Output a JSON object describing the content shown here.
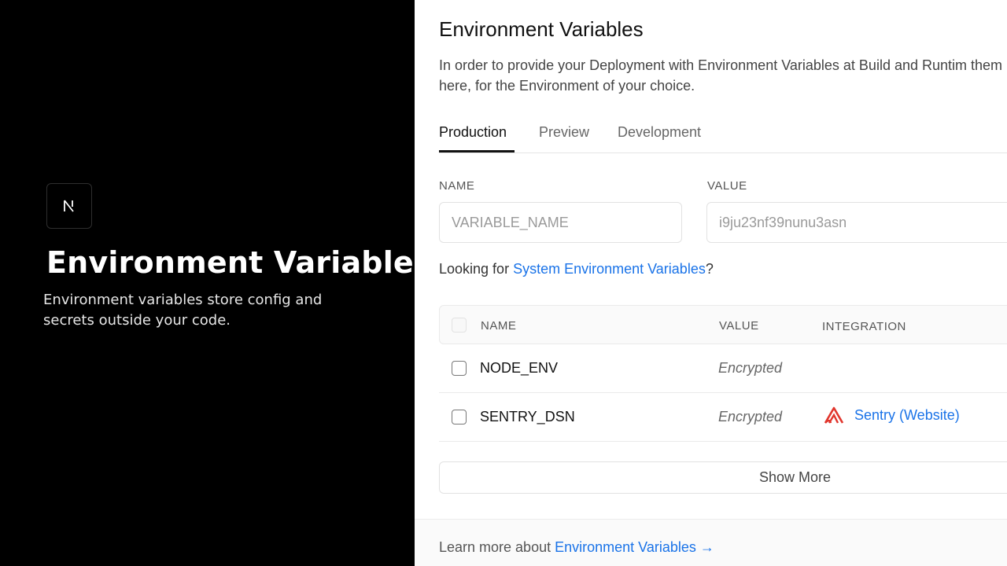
{
  "hero": {
    "logo_icon": "nextjs-logo-icon",
    "title": "Environment Variable",
    "subtitle": "Environment variables store config and secrets outside your code."
  },
  "panel": {
    "title": "Environment Variables",
    "description": "In order to provide your Deployment with Environment Variables at Build and Runtim them right here, for the Environment of your choice.",
    "tabs": [
      {
        "label": "Production",
        "active": true
      },
      {
        "label": "Preview",
        "active": false
      },
      {
        "label": "Development",
        "active": false
      }
    ],
    "form": {
      "name_label": "NAME",
      "name_placeholder": "VARIABLE_NAME",
      "value_label": "VALUE",
      "value_placeholder": "i9ju23nf39nunu3asn"
    },
    "system_hint": {
      "prefix": "Looking for ",
      "link": "System Environment Variables",
      "suffix": "?"
    },
    "table": {
      "headers": [
        "NAME",
        "VALUE",
        "INTEGRATION"
      ],
      "rows": [
        {
          "name": "NODE_ENV",
          "value": "Encrypted",
          "integration": ""
        },
        {
          "name": "SENTRY_DSN",
          "value": "Encrypted",
          "integration": "Sentry (Website)",
          "integration_icon": "sentry-icon"
        }
      ]
    },
    "show_more_label": "Show More",
    "footer": {
      "prefix": "Learn more about ",
      "link": "Environment Variables →"
    }
  },
  "colors": {
    "link": "#1a73e8",
    "sentry": "#e1352c",
    "hero_bg": "#000000"
  }
}
